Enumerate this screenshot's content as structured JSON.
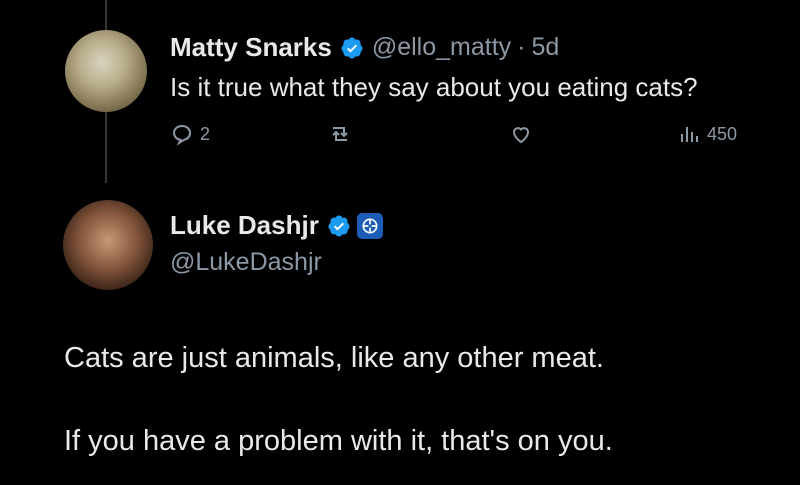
{
  "reply": {
    "author_name": "Matty Snarks",
    "handle": "@ello_matty",
    "separator": "·",
    "age": "5d",
    "text": "Is it true what they say about you eating cats?",
    "reply_count": "2",
    "views": "450",
    "icons": [
      "reply-icon",
      "retweet-icon",
      "like-icon",
      "views-icon"
    ]
  },
  "post": {
    "author_name": "Luke Dashjr",
    "handle": "@LukeDashjr",
    "line1": "Cats are just animals, like any other meat.",
    "line2": "If you have a problem with it, that's on you."
  },
  "colors": {
    "background": "#000000",
    "text": "#e7e9ea",
    "muted": "#8b98a5",
    "verified": "#1d9bf0"
  }
}
